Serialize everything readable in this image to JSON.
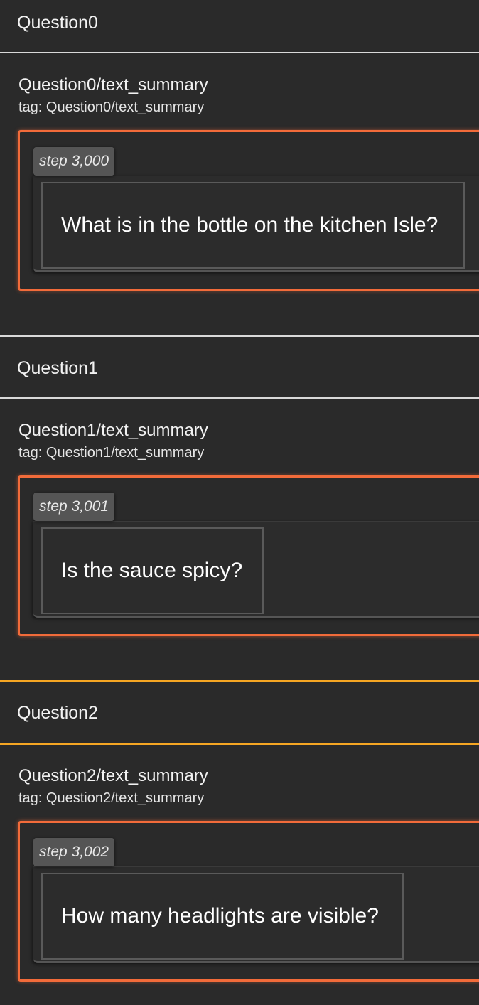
{
  "groups": [
    {
      "header": "Question0",
      "title": "Question0/text_summary",
      "tag": "tag: Question0/text_summary",
      "step": "step 3,000",
      "text": "What is in the bottle on the kitchen Isle?"
    },
    {
      "header": "Question1",
      "title": "Question1/text_summary",
      "tag": "tag: Question1/text_summary",
      "step": "step 3,001",
      "text": "Is the sauce spicy?"
    },
    {
      "header": "Question2",
      "title": "Question2/text_summary",
      "tag": "tag: Question2/text_summary",
      "step": "step 3,002",
      "text": "How many headlights are visible?"
    }
  ],
  "colors": {
    "background": "#2a2a2a",
    "card_border": "#f26b3a",
    "active_divider": "#f5a623",
    "divider": "#d9d9d9",
    "chip": "#555555"
  }
}
